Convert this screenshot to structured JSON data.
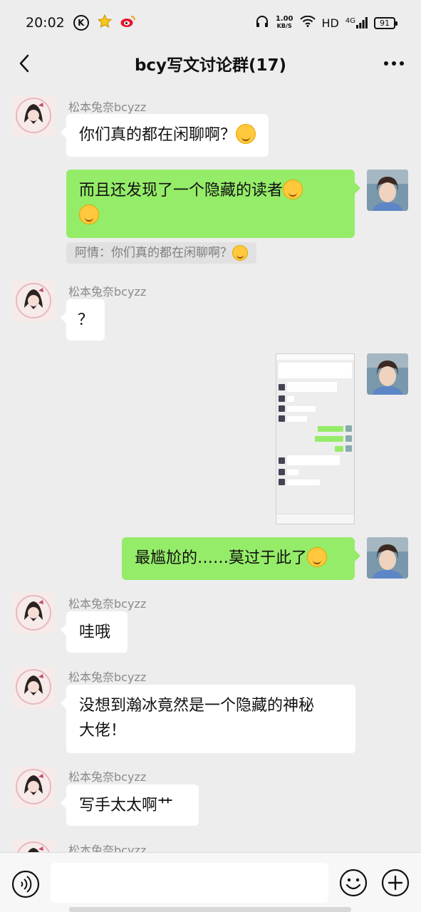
{
  "status": {
    "time": "20:02",
    "speed_value": "1.00",
    "speed_unit": "KB/S",
    "hd": "HD",
    "network": "4G",
    "battery": "91",
    "k_icon": "K"
  },
  "header": {
    "title": "bcy写文讨论群(17)"
  },
  "messages": [
    {
      "sender": "松本兔奈bcyzz",
      "text": "你们真的都在闲聊啊？"
    },
    {
      "text_line1": "而且还发现了一个隐藏的读者"
    },
    {
      "quote": "阿情：你们真的都在闲聊啊？"
    },
    {
      "sender": "松本兔奈bcyzz",
      "text": "？"
    },
    {
      "image": "chat-screenshot"
    },
    {
      "text": "最尴尬的……莫过于此了"
    },
    {
      "sender": "松本兔奈bcyzz",
      "text": "哇哦"
    },
    {
      "sender": "松本兔奈bcyzz",
      "text_line1": "没想到瀚冰竟然是一个隐藏的神秘",
      "text_line2": "大佬！"
    },
    {
      "sender": "松本兔奈bcyzz",
      "text": "写手太太啊艹"
    },
    {
      "sender": "松本兔奈bcyzz"
    }
  ],
  "input": {
    "value": "",
    "placeholder": ""
  },
  "icons": {
    "back": "chevron-left-icon",
    "more": "more-dots-icon",
    "voice": "voice-icon",
    "emoji": "emoji-icon",
    "plus": "plus-icon"
  }
}
